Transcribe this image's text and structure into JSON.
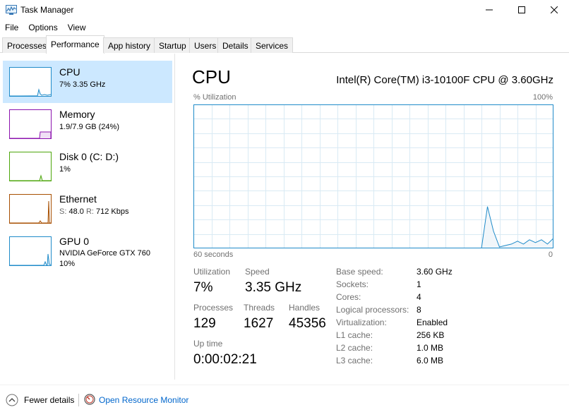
{
  "window": {
    "title": "Task Manager"
  },
  "menu": [
    "File",
    "Options",
    "View"
  ],
  "tabs": [
    "Processes",
    "Performance",
    "App history",
    "Startup",
    "Users",
    "Details",
    "Services"
  ],
  "active_tab": "Performance",
  "resources": [
    {
      "name": "CPU",
      "sub": "7% 3.35 GHz",
      "color": "#1f8bc9"
    },
    {
      "name": "Memory",
      "sub": "1.9/7.9 GB (24%)",
      "color": "#8b12ae"
    },
    {
      "name": "Disk 0 (C: D:)",
      "sub": "1%",
      "color": "#4da60c"
    },
    {
      "name": "Ethernet",
      "sub_label_s": "S:",
      "sub_val_s": "48.0",
      "sub_label_r": "R:",
      "sub_val_r": "712 Kbps",
      "color": "#a74f01"
    },
    {
      "name": "GPU 0",
      "sub": "NVIDIA GeForce GTX 760",
      "sub2": "10%",
      "color": "#1f8bc9"
    }
  ],
  "detail": {
    "title": "CPU",
    "model": "Intel(R) Core(TM) i3-10100F CPU @ 3.60GHz",
    "graph_label_top_left": "% Utilization",
    "graph_label_top_right": "100%",
    "graph_label_bottom_left": "60 seconds",
    "graph_label_bottom_right": "0",
    "stats": {
      "utilization_label": "Utilization",
      "utilization": "7%",
      "speed_label": "Speed",
      "speed": "3.35 GHz",
      "processes_label": "Processes",
      "processes": "129",
      "threads_label": "Threads",
      "threads": "1627",
      "handles_label": "Handles",
      "handles": "45356",
      "uptime_label": "Up time",
      "uptime": "0:00:02:21"
    },
    "specs": [
      {
        "key": "Base speed:",
        "value": "3.60 GHz"
      },
      {
        "key": "Sockets:",
        "value": "1"
      },
      {
        "key": "Cores:",
        "value": "4"
      },
      {
        "key": "Logical processors:",
        "value": "8"
      },
      {
        "key": "Virtualization:",
        "value": "Enabled"
      },
      {
        "key": "L1 cache:",
        "value": "256 KB"
      },
      {
        "key": "L2 cache:",
        "value": "1.0 MB"
      },
      {
        "key": "L3 cache:",
        "value": "6.0 MB"
      }
    ]
  },
  "cpu_history": [
    0,
    0,
    0,
    0,
    0,
    0,
    0,
    0,
    0,
    0,
    0,
    0,
    0,
    0,
    0,
    0,
    0,
    0,
    0,
    0,
    0,
    0,
    0,
    0,
    0,
    0,
    0,
    0,
    0,
    0,
    0,
    0,
    0,
    0,
    0,
    0,
    0,
    0,
    0,
    0,
    0,
    0,
    0,
    0,
    0,
    0,
    0,
    0,
    0,
    0,
    0,
    0,
    0,
    0,
    0,
    0,
    0,
    0,
    0,
    0,
    0,
    0,
    0,
    0,
    0,
    0,
    0,
    0,
    0,
    0,
    0,
    0,
    0,
    0,
    0,
    0,
    0,
    0,
    0,
    0,
    0,
    0,
    0,
    0,
    0,
    0,
    0,
    0,
    0,
    0,
    0,
    0,
    0,
    0,
    0,
    0,
    0,
    0,
    0,
    0,
    0,
    0,
    0,
    0,
    0,
    0,
    0,
    0,
    0,
    0,
    0,
    0,
    0,
    0,
    0,
    0,
    0,
    0,
    0,
    0,
    0,
    0,
    0,
    0,
    0,
    0,
    0,
    0,
    0,
    0,
    0,
    0,
    0,
    0,
    0,
    0,
    0,
    0,
    0,
    0,
    0,
    0,
    0,
    0,
    0,
    0,
    0,
    0,
    0,
    0,
    0,
    0,
    0,
    0,
    0,
    0,
    0,
    0,
    0,
    0,
    0,
    0,
    0,
    0,
    0,
    0,
    0,
    0,
    0,
    0,
    0,
    0,
    0,
    0,
    0,
    0,
    0,
    0,
    0,
    0,
    0,
    0,
    0,
    0,
    0,
    0,
    0,
    0,
    0,
    0,
    0,
    0,
    0,
    0,
    0,
    0,
    0,
    0,
    0,
    0,
    0,
    0,
    0,
    0,
    0,
    0,
    0,
    0,
    0,
    0,
    0,
    0,
    0,
    0,
    0,
    0,
    0,
    0,
    0,
    0,
    0,
    0,
    0,
    0,
    0,
    0,
    0,
    0,
    0,
    0,
    0,
    0,
    0,
    0,
    0,
    0,
    0,
    0,
    0,
    0,
    0,
    0,
    0,
    0,
    0,
    0,
    0,
    0,
    0,
    0,
    0,
    0,
    0,
    0,
    0,
    0,
    0,
    0,
    0,
    0,
    0,
    0,
    0,
    0,
    0,
    0,
    0,
    0,
    0,
    0,
    0,
    0,
    0,
    0,
    0,
    0,
    0,
    0,
    0,
    0,
    0,
    0,
    0,
    0,
    0,
    0,
    0,
    0,
    0,
    0,
    0,
    0,
    0,
    0,
    0,
    0,
    0,
    0,
    0,
    0,
    0,
    0,
    0,
    0,
    0,
    0,
    0,
    0,
    0,
    0,
    0,
    0,
    0,
    0,
    0,
    0,
    0,
    0,
    0,
    0,
    0,
    0,
    0,
    0,
    0,
    0,
    0,
    0,
    0,
    0,
    0,
    0,
    0,
    0,
    0,
    0,
    0,
    0,
    0,
    0,
    0,
    0,
    0,
    0,
    0,
    0,
    0,
    0,
    0,
    0,
    0,
    0,
    0,
    0,
    0,
    0,
    0,
    0,
    0,
    0,
    0,
    0,
    0,
    0,
    0,
    0
  ],
  "cpu_series": [
    0,
    0,
    0,
    0,
    0,
    0,
    0,
    0,
    0,
    0,
    0,
    0,
    0,
    0,
    0,
    0,
    0,
    0,
    0,
    0,
    0,
    0,
    0,
    0,
    0,
    0,
    0,
    0,
    0,
    0,
    0,
    0,
    0,
    0,
    0,
    0,
    0,
    0,
    0,
    0,
    0,
    0,
    0,
    0,
    0,
    0,
    0,
    0,
    0,
    0,
    0,
    0,
    0,
    0,
    0,
    0,
    0,
    0,
    0,
    0,
    0,
    0,
    0,
    0,
    0,
    0,
    0,
    0,
    0,
    0,
    0,
    0,
    0,
    0,
    0,
    0,
    0,
    0,
    0,
    0,
    0,
    0,
    0,
    0,
    0,
    0,
    0,
    0,
    0,
    0,
    0,
    0,
    0,
    0,
    0,
    0,
    0,
    0,
    0,
    0,
    0,
    0,
    0,
    0,
    0,
    0,
    0,
    0,
    0,
    0,
    0,
    0,
    0,
    0,
    0,
    0,
    0,
    0,
    0,
    0,
    0,
    0,
    0,
    0,
    0,
    0,
    0,
    0,
    0,
    0,
    0,
    0,
    0,
    0,
    0,
    0,
    0,
    0,
    0,
    0,
    0,
    0,
    0,
    0,
    0,
    0,
    0,
    0,
    0,
    0,
    0,
    0,
    0,
    0,
    0,
    0,
    0,
    0,
    0,
    0,
    0,
    0,
    0,
    0,
    0,
    0,
    0,
    0,
    0,
    0,
    0,
    0,
    0,
    0,
    0,
    0,
    0,
    0,
    0,
    0,
    0,
    0,
    0,
    0,
    0,
    0,
    0,
    0,
    0,
    0,
    0,
    0,
    0,
    0,
    0,
    0,
    0,
    0,
    0,
    0,
    0,
    0,
    0,
    0,
    0,
    0,
    0,
    0,
    0,
    0,
    0,
    0,
    0,
    0,
    0,
    0,
    0,
    0,
    0,
    0,
    0,
    0,
    0,
    0,
    0,
    0,
    0,
    0,
    0,
    0,
    0,
    0,
    0,
    0,
    0,
    0,
    0,
    0,
    0,
    0,
    0,
    0,
    0,
    0,
    0,
    0,
    0,
    0,
    0,
    0,
    0,
    0,
    0,
    0,
    0,
    0,
    0,
    0,
    0,
    0,
    0,
    0,
    0,
    0,
    0,
    0,
    0,
    0,
    0,
    0,
    0,
    0,
    0,
    0,
    0,
    0,
    0,
    0,
    0,
    0,
    0,
    0,
    0,
    0,
    0,
    0,
    0,
    0,
    0,
    0,
    0,
    0,
    0,
    0,
    0,
    0,
    0,
    0,
    0,
    0,
    0,
    0,
    0,
    0,
    0,
    0,
    0,
    0,
    0,
    0,
    0,
    0,
    0,
    0,
    0,
    0,
    0,
    0,
    0,
    0,
    0,
    0,
    0,
    0,
    0,
    0,
    0,
    0,
    0,
    0,
    0,
    0,
    0,
    0,
    0,
    0,
    0,
    0,
    0,
    0,
    0,
    0,
    0,
    0,
    0,
    0,
    0,
    0,
    0,
    0,
    0,
    0,
    0,
    0,
    0,
    0,
    0,
    0,
    0,
    0,
    0,
    0,
    0,
    0,
    0,
    0,
    0,
    0,
    0,
    0,
    0,
    0,
    0,
    0,
    0,
    0,
    0
  ],
  "cpu_utilization_history": {
    "seconds_ago": [
      60,
      12,
      11,
      10,
      9,
      8,
      7,
      6,
      5,
      4,
      3,
      2,
      1,
      0
    ],
    "percent": [
      0,
      0,
      29,
      12,
      1,
      2,
      3,
      5,
      3,
      6,
      4,
      6,
      3,
      7
    ]
  },
  "footer": {
    "fewer_details": "Fewer details",
    "open_rm": "Open Resource Monitor"
  },
  "colors": {
    "cpu": "#1f8bc9",
    "cpu_fill": "#f1f6fa",
    "grid": "#d9eaf4",
    "accent": "#0066cc",
    "selected": "#cce8ff"
  }
}
